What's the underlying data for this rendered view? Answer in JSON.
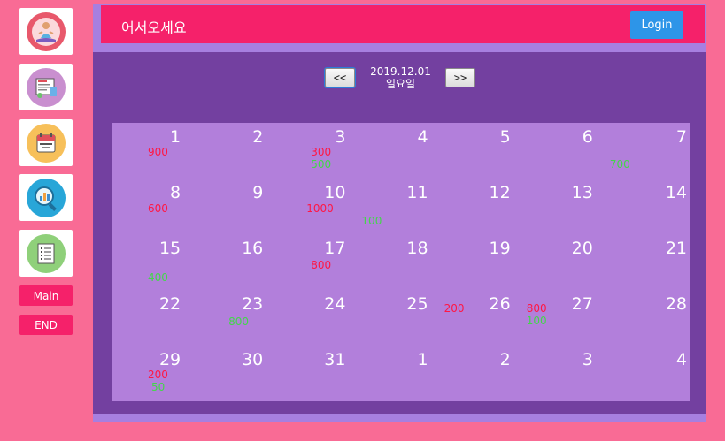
{
  "sidebar": {
    "icons": [
      {
        "name": "meditation-icon",
        "color": "#e8586b"
      },
      {
        "name": "diet-board-icon",
        "color": "#c98fcf"
      },
      {
        "name": "dday-calendar-icon",
        "color": "#f7c05a"
      },
      {
        "name": "chart-search-icon",
        "color": "#28a6d8"
      },
      {
        "name": "checklist-icon",
        "color": "#8fd07a"
      }
    ],
    "main_label": "Main",
    "end_label": "END"
  },
  "header": {
    "greeting": "어서오세요",
    "login_label": "Login"
  },
  "date_nav": {
    "prev_label": "<<",
    "next_label": ">>",
    "date": "2019.12.01",
    "weekday": "일요일"
  },
  "calendar": {
    "weeks": [
      [
        {
          "day": "1",
          "red": "900",
          "green": ""
        },
        {
          "day": "2",
          "red": "",
          "green": ""
        },
        {
          "day": "3",
          "red": "300",
          "green": "500"
        },
        {
          "day": "4",
          "red": "",
          "green": ""
        },
        {
          "day": "5",
          "red": "",
          "green": ""
        },
        {
          "day": "6",
          "red": "",
          "green": ""
        },
        {
          "day": "7",
          "red": "",
          "green": "700"
        }
      ],
      [
        {
          "day": "8",
          "red": "600",
          "green": ""
        },
        {
          "day": "9",
          "red": "",
          "green": ""
        },
        {
          "day": "10",
          "red": "1000",
          "green": ""
        },
        {
          "day": "11",
          "red": "",
          "green": "100"
        },
        {
          "day": "12",
          "red": "",
          "green": ""
        },
        {
          "day": "13",
          "red": "",
          "green": ""
        },
        {
          "day": "14",
          "red": "",
          "green": ""
        }
      ],
      [
        {
          "day": "15",
          "red": "",
          "green": "400"
        },
        {
          "day": "16",
          "red": "",
          "green": ""
        },
        {
          "day": "17",
          "red": "800",
          "green": ""
        },
        {
          "day": "18",
          "red": "",
          "green": ""
        },
        {
          "day": "19",
          "red": "",
          "green": ""
        },
        {
          "day": "20",
          "red": "",
          "green": ""
        },
        {
          "day": "21",
          "red": "",
          "green": ""
        }
      ],
      [
        {
          "day": "22",
          "red": "",
          "green": ""
        },
        {
          "day": "23",
          "red": "",
          "green": "800"
        },
        {
          "day": "24",
          "red": "",
          "green": ""
        },
        {
          "day": "25",
          "red": "",
          "green": ""
        },
        {
          "day": "26",
          "red": "200",
          "green": ""
        },
        {
          "day": "27",
          "red": "800",
          "green": "100"
        },
        {
          "day": "28",
          "red": "",
          "green": ""
        }
      ],
      [
        {
          "day": "29",
          "red": "200",
          "green": "50"
        },
        {
          "day": "30",
          "red": "",
          "green": ""
        },
        {
          "day": "31",
          "red": "",
          "green": ""
        },
        {
          "day": "1",
          "red": "",
          "green": ""
        },
        {
          "day": "2",
          "red": "",
          "green": ""
        },
        {
          "day": "3",
          "red": "",
          "green": ""
        },
        {
          "day": "4",
          "red": "",
          "green": ""
        }
      ]
    ]
  }
}
